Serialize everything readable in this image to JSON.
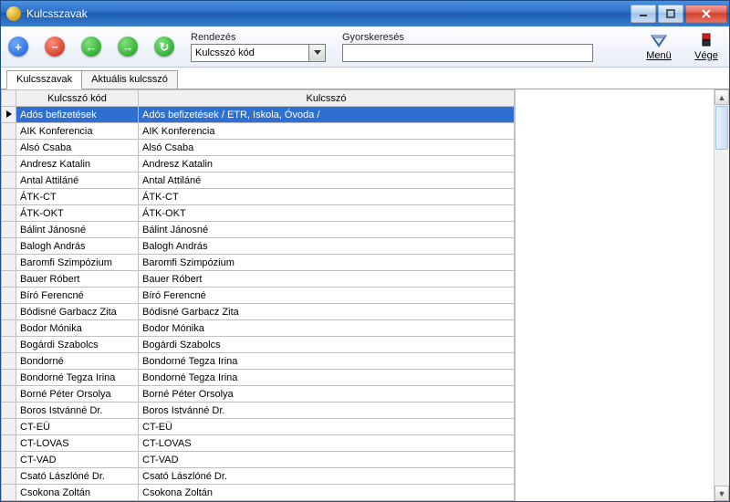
{
  "window": {
    "title": "Kulcsszavak"
  },
  "toolbar": {
    "sort_label": "Rendezés",
    "sort_value": "Kulcsszó kód",
    "search_label": "Gyorskeresés",
    "search_value": "",
    "menu_label": "Menü",
    "exit_label": "Vége"
  },
  "tabs": {
    "keywords": "Kulcsszavak",
    "current": "Aktuális kulcsszó"
  },
  "grid": {
    "col_code": "Kulcsszó kód",
    "col_keyword": "Kulcsszó",
    "selected_index": 0,
    "rows": [
      {
        "code": "Adós befizetések",
        "kw": "Adós befizetések / ETR, Iskola, Óvoda /"
      },
      {
        "code": "AIK Konferencia",
        "kw": "AIK Konferencia"
      },
      {
        "code": "Alsó Csaba",
        "kw": "Alsó Csaba"
      },
      {
        "code": "Andresz Katalin",
        "kw": "Andresz Katalin"
      },
      {
        "code": "Antal Attiláné",
        "kw": "Antal Attiláné"
      },
      {
        "code": "ÁTK-CT",
        "kw": "ÁTK-CT"
      },
      {
        "code": "ÁTK-OKT",
        "kw": "ÁTK-OKT"
      },
      {
        "code": "Bálint Jánosné",
        "kw": "Bálint Jánosné"
      },
      {
        "code": "Balogh András",
        "kw": "Balogh András"
      },
      {
        "code": "Baromfi Szimpózium",
        "kw": "Baromfi Szimpózium"
      },
      {
        "code": "Bauer Róbert",
        "kw": "Bauer Róbert"
      },
      {
        "code": "Bíró Ferencné",
        "kw": "Bíró Ferencné"
      },
      {
        "code": "Bódisné Garbacz Zita",
        "kw": "Bódisné Garbacz Zita"
      },
      {
        "code": "Bodor Mónika",
        "kw": "Bodor Mónika"
      },
      {
        "code": "Bogárdi Szabolcs",
        "kw": "Bogárdi Szabolcs"
      },
      {
        "code": "Bondorné",
        "kw": "Bondorné Tegza Irina"
      },
      {
        "code": "Bondorné Tegza Irina",
        "kw": "Bondorné Tegza Irina"
      },
      {
        "code": "Borné Péter Orsolya",
        "kw": "Borné Péter Orsolya"
      },
      {
        "code": "Boros Istvánné Dr.",
        "kw": "Boros Istvánné Dr."
      },
      {
        "code": "CT-EÜ",
        "kw": "CT-EÜ"
      },
      {
        "code": "CT-LOVAS",
        "kw": "CT-LOVAS"
      },
      {
        "code": "CT-VAD",
        "kw": "CT-VAD"
      },
      {
        "code": "Csató Lászlóné Dr.",
        "kw": "Csató Lászlóné Dr."
      },
      {
        "code": "Csokona Zoltán",
        "kw": "Csokona Zoltán"
      }
    ]
  }
}
